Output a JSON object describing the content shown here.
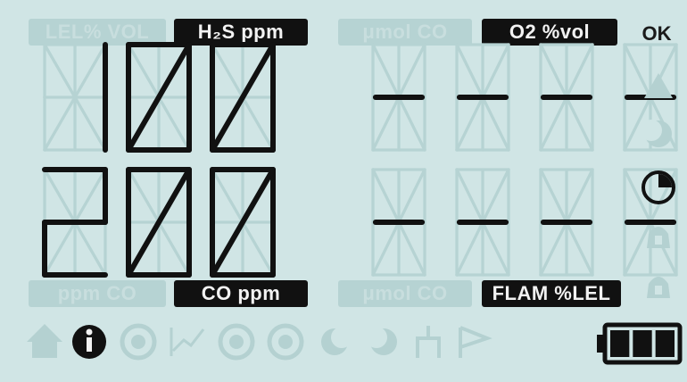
{
  "row1": {
    "labels": [
      {
        "text": "LEL% VOL",
        "active": false
      },
      {
        "text": "H₂S ppm",
        "active": true
      },
      {
        "text": "μmol CO",
        "active": false
      },
      {
        "text": "O2 %vol",
        "active": true
      }
    ],
    "main_value": "100",
    "secondary_value": "----"
  },
  "row2": {
    "labels": [
      {
        "text": "ppm CO",
        "active": false
      },
      {
        "text": "CO ppm",
        "active": true
      },
      {
        "text": "μmol CO",
        "active": false
      },
      {
        "text": "FLAM %LEL",
        "active": true
      }
    ],
    "main_value": "200",
    "secondary_value": "----"
  },
  "status_text": "OK",
  "right_icons": [
    {
      "icon": "warning-icon",
      "active": false
    },
    {
      "icon": "half-moon-icon",
      "active": false
    },
    {
      "icon": "pie-timer-icon",
      "active": true
    },
    {
      "icon": "alarm-bell-icon",
      "active": false
    },
    {
      "icon": "alarm-bell-outline-icon",
      "active": false
    }
  ],
  "bottom_icons": [
    {
      "icon": "home-icon",
      "active": false
    },
    {
      "icon": "info-icon",
      "active": true
    },
    {
      "icon": "zero-icon",
      "active": false
    },
    {
      "icon": "trend-icon",
      "active": false
    },
    {
      "icon": "bump-b-icon",
      "active": false
    },
    {
      "icon": "calibration-c-icon",
      "active": false
    },
    {
      "icon": "moon-left-icon",
      "active": false
    },
    {
      "icon": "moon-right-icon",
      "active": false
    },
    {
      "icon": "pump-icon",
      "active": false
    },
    {
      "icon": "flag-icon",
      "active": false
    }
  ],
  "battery": {
    "icon": "battery-icon",
    "bars": 3,
    "max_bars": 3
  },
  "colors": {
    "lcd_background": "#d0e5e5",
    "segment_on": "#111111",
    "segment_off": "#b6d3d3",
    "label_on_bg": "#111111"
  }
}
